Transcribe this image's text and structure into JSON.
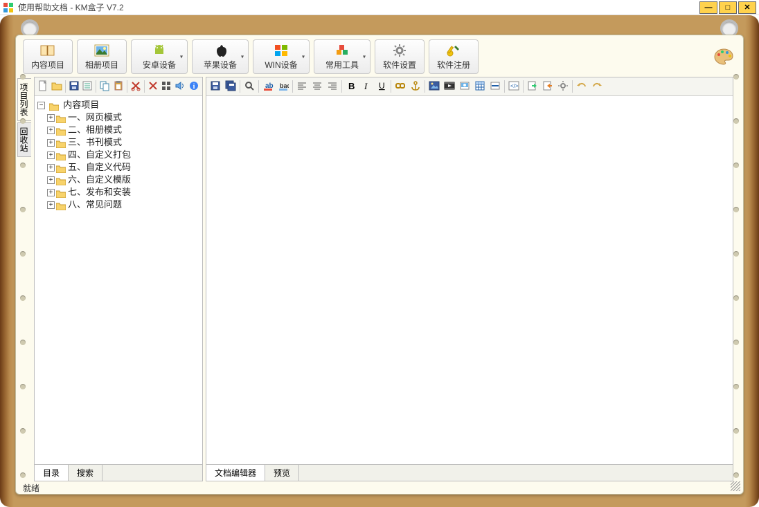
{
  "window": {
    "title": "使用帮助文档 - KM盒子 V7.2"
  },
  "main_toolbar": [
    {
      "key": "content",
      "label": "内容项目",
      "dropdown": false
    },
    {
      "key": "album",
      "label": "相册项目",
      "dropdown": false
    },
    {
      "key": "android",
      "label": "安卓设备",
      "dropdown": true
    },
    {
      "key": "apple",
      "label": "苹果设备",
      "dropdown": true
    },
    {
      "key": "win",
      "label": "WIN设备",
      "dropdown": true
    },
    {
      "key": "tools",
      "label": "常用工具",
      "dropdown": true
    },
    {
      "key": "settings",
      "label": "软件设置",
      "dropdown": false
    },
    {
      "key": "register",
      "label": "软件注册",
      "dropdown": false
    }
  ],
  "vtabs": [
    {
      "label": "项目列表",
      "active": true
    },
    {
      "label": "回收站",
      "active": false
    }
  ],
  "left_toolbar_icons": [
    "new-file-icon",
    "open-folder-icon",
    "save-icon",
    "properties-icon",
    "copy-node-icon",
    "paste-node-icon",
    "cut-icon",
    "cross-icon",
    "grid-icon",
    "sound-icon",
    "info-icon"
  ],
  "tree": {
    "root": {
      "label": "内容项目"
    },
    "children": [
      {
        "label": "一、网页模式"
      },
      {
        "label": "二、相册模式"
      },
      {
        "label": "三、书刊模式"
      },
      {
        "label": "四、自定义打包"
      },
      {
        "label": "五、自定义代码"
      },
      {
        "label": "六、自定义模版"
      },
      {
        "label": "七、发布和安装"
      },
      {
        "label": "八、常见问题"
      }
    ]
  },
  "left_tabs": [
    {
      "label": "目录",
      "active": true
    },
    {
      "label": "搜索",
      "active": false
    }
  ],
  "editor_toolbar_icons": [
    "save-icon",
    "save-all-icon",
    "sep",
    "find-icon",
    "sep",
    "font-color-icon",
    "highlight-icon",
    "sep",
    "align-left-icon",
    "align-center-icon",
    "align-right-icon",
    "sep",
    "bold-icon",
    "italic-icon",
    "underline-icon",
    "sep",
    "insert-link-icon",
    "insert-anchor-icon",
    "sep",
    "insert-image-icon",
    "insert-video-icon",
    "insert-media-icon",
    "insert-table-icon",
    "insert-hr-icon",
    "sep",
    "source-code-icon",
    "sep",
    "import-icon",
    "export-icon",
    "settings-icon",
    "sep",
    "undo-icon",
    "redo-icon"
  ],
  "right_tabs": [
    {
      "label": "文档编辑器",
      "active": true
    },
    {
      "label": "预览",
      "active": false
    }
  ],
  "status": {
    "text": "就绪"
  }
}
